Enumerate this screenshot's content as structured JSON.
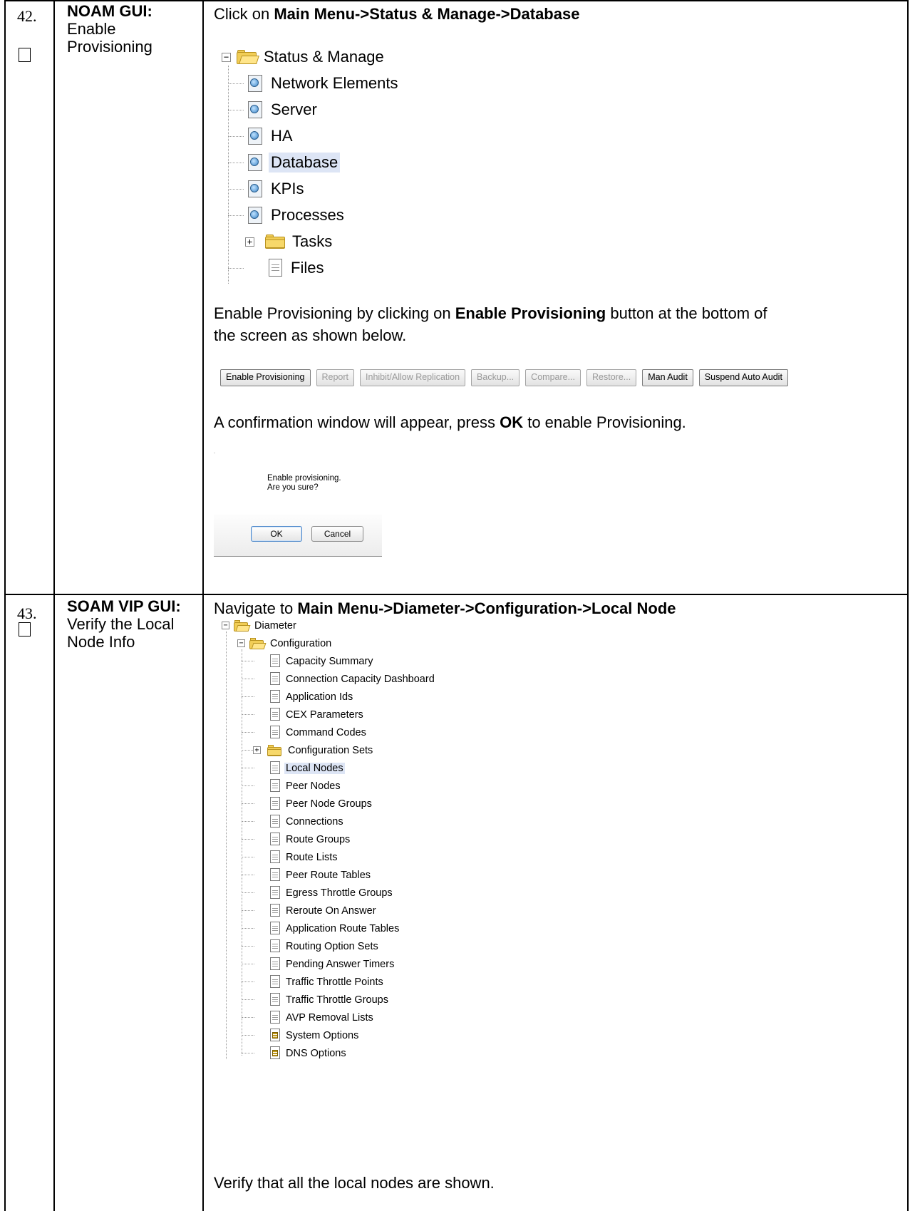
{
  "step42": {
    "number": "42.",
    "title": "NOAM GUI:",
    "subtitle_line1": "Enable",
    "subtitle_line2": "Provisioning",
    "instr_prefix": "Click on ",
    "instr_bold": "Main Menu->Status & Manage->Database",
    "tree": [
      {
        "label": "Status & Manage"
      },
      {
        "label": "Network Elements"
      },
      {
        "label": "Server"
      },
      {
        "label": "HA"
      },
      {
        "label": "Database"
      },
      {
        "label": "KPIs"
      },
      {
        "label": "Processes"
      },
      {
        "label": "Tasks"
      },
      {
        "label": "Files"
      }
    ],
    "para2_prefix": "Enable Provisioning by clicking on ",
    "para2_bold": "Enable Provisioning",
    "para2_suffix_line1": " button at the bottom of",
    "para2_line2": "the screen as shown below.",
    "buttons": [
      {
        "label": "Enable Provisioning"
      },
      {
        "label": "Report"
      },
      {
        "label": "Inhibit/Allow Replication"
      },
      {
        "label": "Backup..."
      },
      {
        "label": "Compare..."
      },
      {
        "label": "Restore..."
      },
      {
        "label": "Man Audit"
      },
      {
        "label": "Suspend Auto Audit"
      }
    ],
    "para3_prefix": "A confirmation window will appear, press ",
    "para3_bold": "OK",
    "para3_suffix": " to enable Provisioning.",
    "dialog": {
      "line1": "Enable provisioning.",
      "line2": "Are you sure?",
      "ok": "OK",
      "cancel": "Cancel"
    }
  },
  "step43": {
    "number": "43.",
    "title": "SOAM VIP GUI:",
    "subtitle_line1": "Verify the Local",
    "subtitle_line2": "Node Info",
    "instr_prefix": "Navigate to ",
    "instr_bold": "Main Menu->Diameter->Configuration->Local Node",
    "tree": [
      {
        "label": "Diameter"
      },
      {
        "label": "Configuration"
      },
      {
        "label": "Capacity Summary"
      },
      {
        "label": "Connection Capacity Dashboard"
      },
      {
        "label": "Application Ids"
      },
      {
        "label": "CEX Parameters"
      },
      {
        "label": "Command Codes"
      },
      {
        "label": "Configuration Sets"
      },
      {
        "label": "Local Nodes"
      },
      {
        "label": "Peer Nodes"
      },
      {
        "label": "Peer Node Groups"
      },
      {
        "label": "Connections"
      },
      {
        "label": "Route Groups"
      },
      {
        "label": "Route Lists"
      },
      {
        "label": "Peer Route Tables"
      },
      {
        "label": "Egress Throttle Groups"
      },
      {
        "label": "Reroute On Answer"
      },
      {
        "label": "Application Route Tables"
      },
      {
        "label": "Routing Option Sets"
      },
      {
        "label": "Pending Answer Timers"
      },
      {
        "label": "Traffic Throttle Points"
      },
      {
        "label": "Traffic Throttle Groups"
      },
      {
        "label": "AVP Removal Lists"
      },
      {
        "label": "System Options"
      },
      {
        "label": "DNS Options"
      }
    ],
    "footer": "Verify that all the local nodes are shown."
  }
}
